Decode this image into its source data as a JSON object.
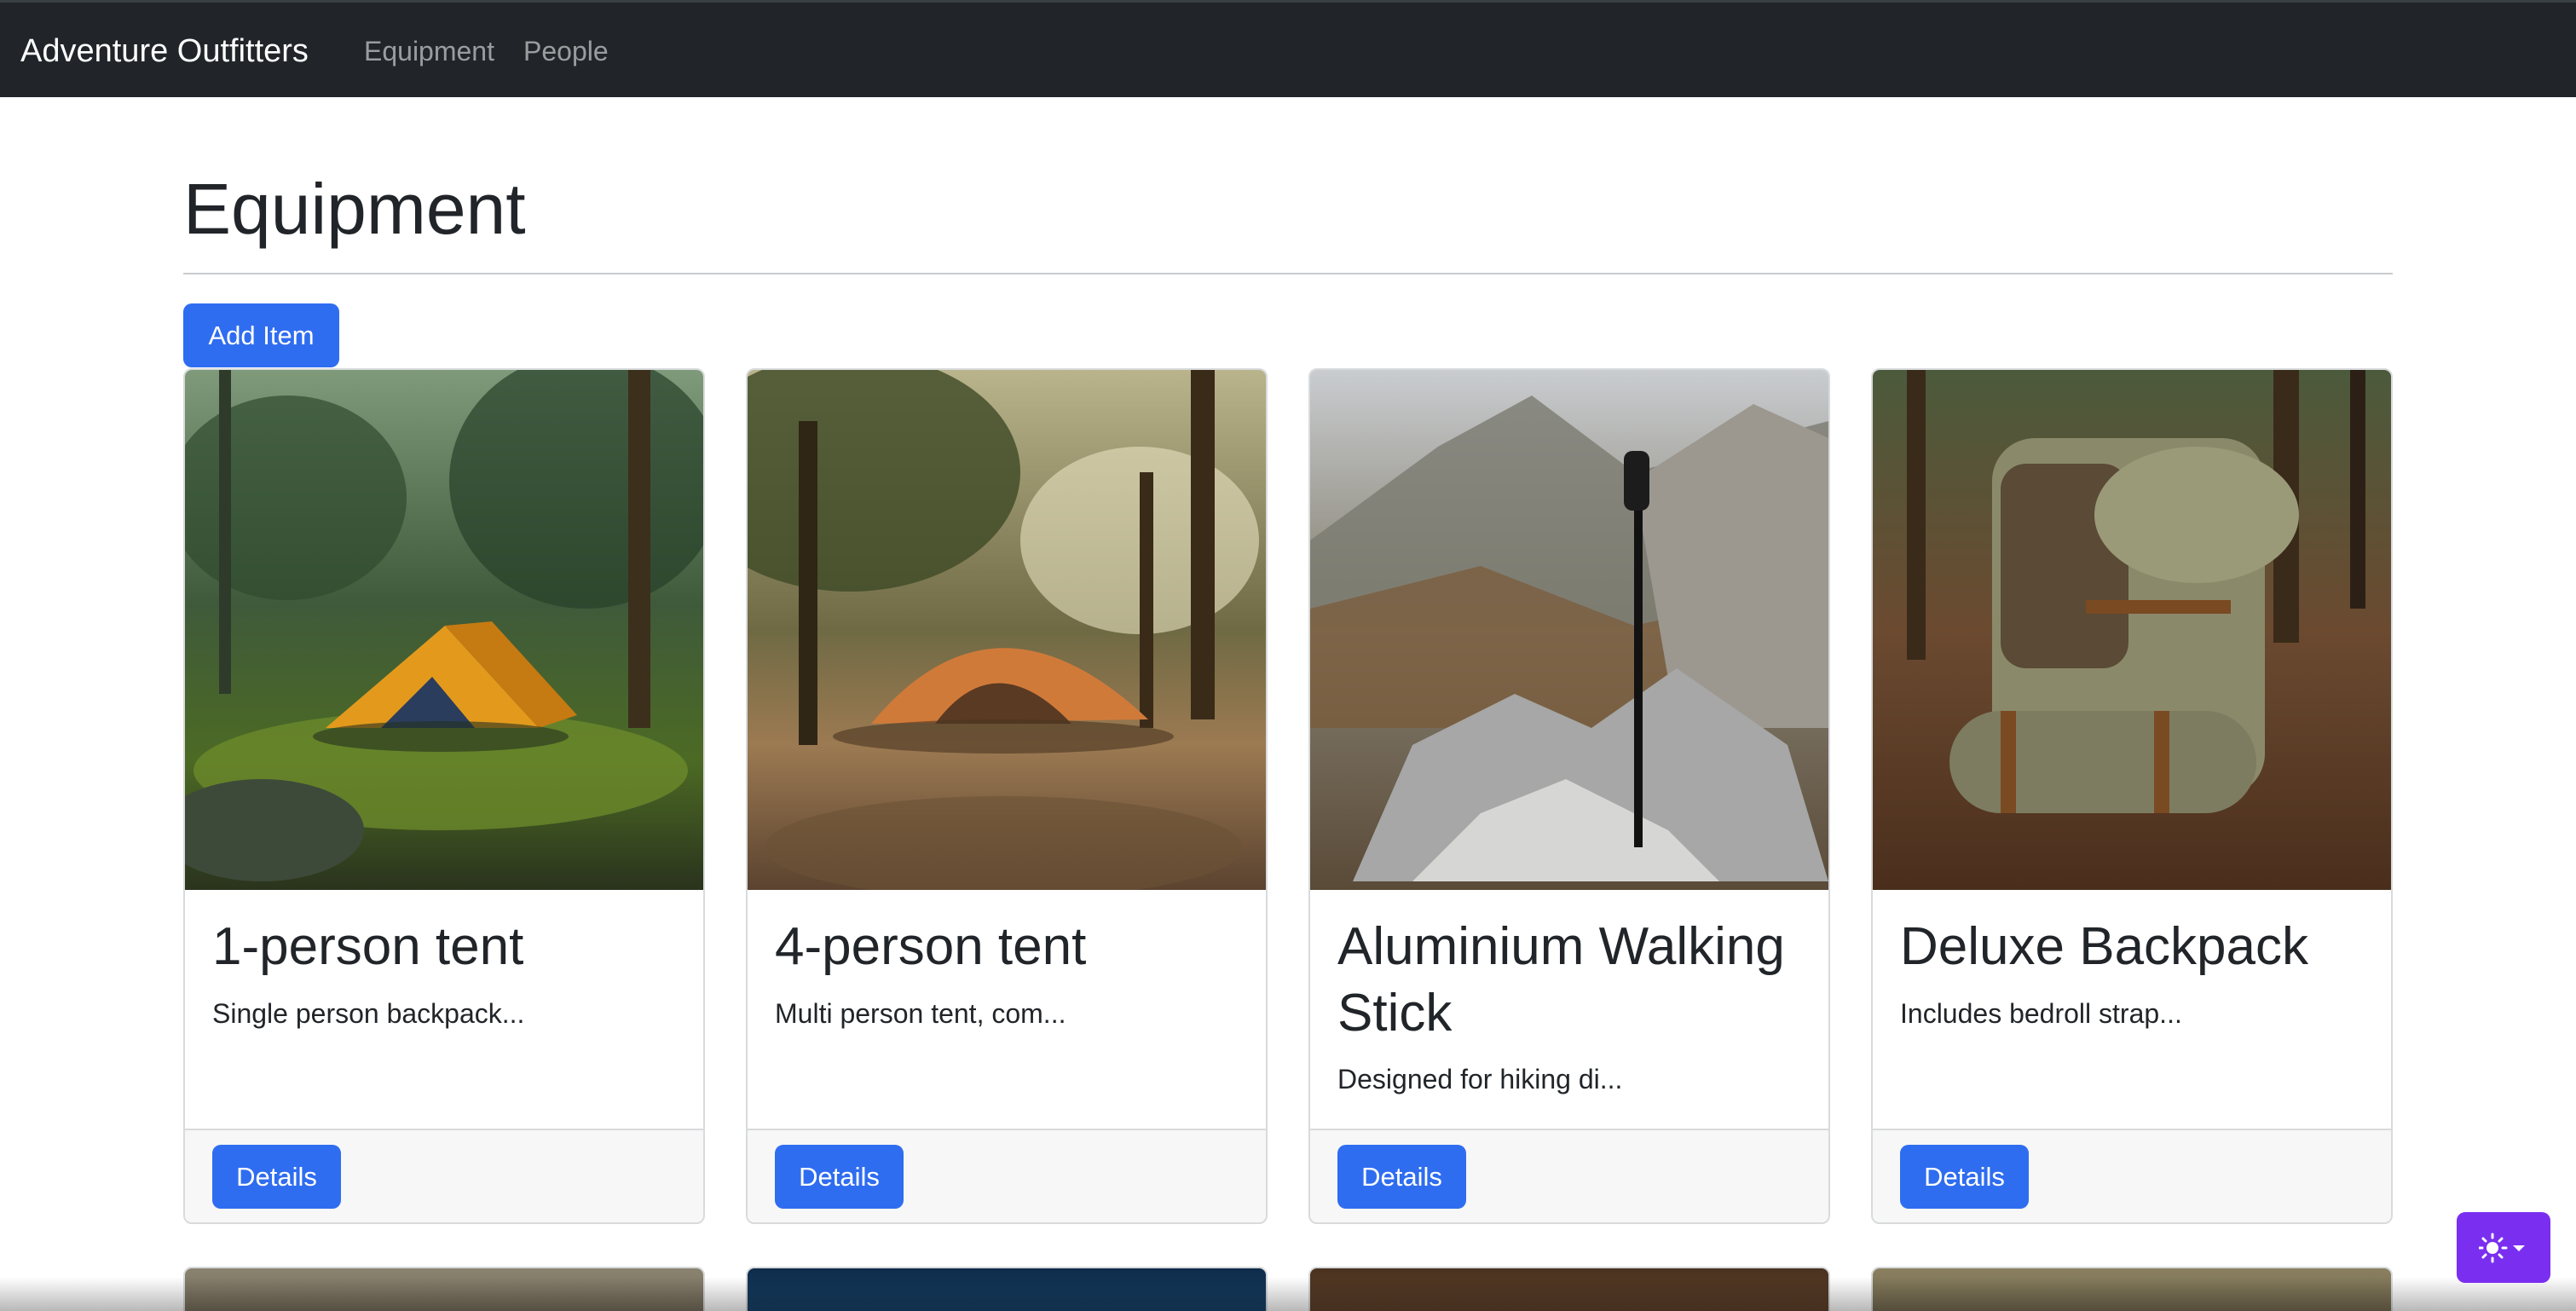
{
  "navbar": {
    "brand": "Adventure Outfitters",
    "links": [
      "Equipment",
      "People"
    ]
  },
  "page": {
    "title": "Equipment",
    "add_button": "Add Item"
  },
  "cards": [
    {
      "title": "1-person tent",
      "description": "Single person backpack...",
      "button": "Details",
      "image": "orange-tent-forest-image"
    },
    {
      "title": "4-person tent",
      "description": "Multi person tent, com...",
      "button": "Details",
      "image": "dome-tent-pines-image"
    },
    {
      "title": "Aluminium Walking Stick",
      "description": "Designed for hiking di...",
      "button": "Details",
      "image": "walking-stick-mountain-image"
    },
    {
      "title": "Deluxe Backpack",
      "description": "Includes bedroll strap...",
      "button": "Details",
      "image": "backpack-forest-image"
    }
  ],
  "theme_toggle": {
    "icon": "sun-icon",
    "caret": "chevron-down-icon"
  },
  "colors": {
    "navbar_bg": "#212529",
    "primary": "#2f6df0",
    "theme_toggle_bg": "#7a2ff0"
  }
}
